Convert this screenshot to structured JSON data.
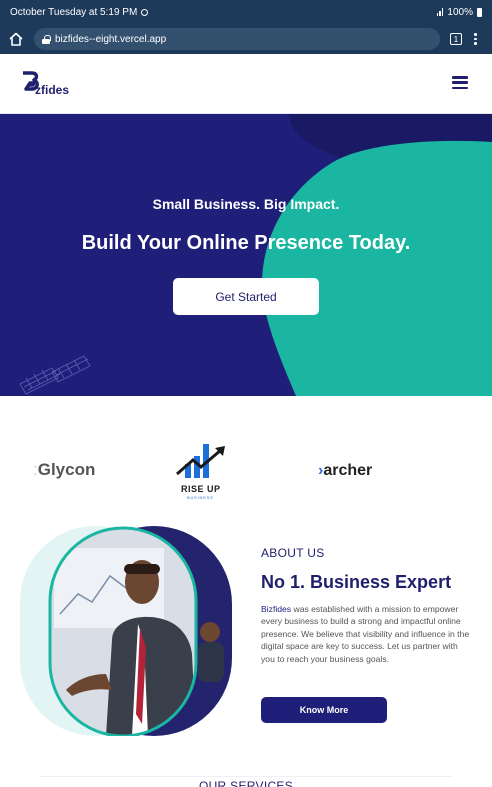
{
  "status_bar": {
    "time_text": "October Tuesday at 5:19 PM",
    "battery_text": "100%"
  },
  "browser": {
    "url": "bizfides--eight.vercel.app",
    "tab_count": "1"
  },
  "header": {
    "logo_text": "zfides"
  },
  "hero": {
    "tagline": "Small Business. Big Impact.",
    "title": "Build Your Online Presence Today.",
    "cta_label": "Get Started"
  },
  "partners": {
    "glycon": "Glycon",
    "riseup_line1": "RISE UP",
    "riseup_line2": "BUSINESS",
    "archer": "archer"
  },
  "about": {
    "eyebrow": "ABOUT US",
    "title": "No 1. Business Expert",
    "body_brand": "Bizfides",
    "body": " was established with a mission to empower every business to build a strong and impactful online presence. We believe that visibility and influence in the digital space are key to success. Let us partner with you to reach your business goals.",
    "cta_label": "Know More"
  },
  "services": {
    "heading": "OUR SERVICES"
  },
  "colors": {
    "brand_navy": "#1f1f7a",
    "accent_teal": "#1bb6a2",
    "browser_chrome": "#1e3a5a"
  }
}
